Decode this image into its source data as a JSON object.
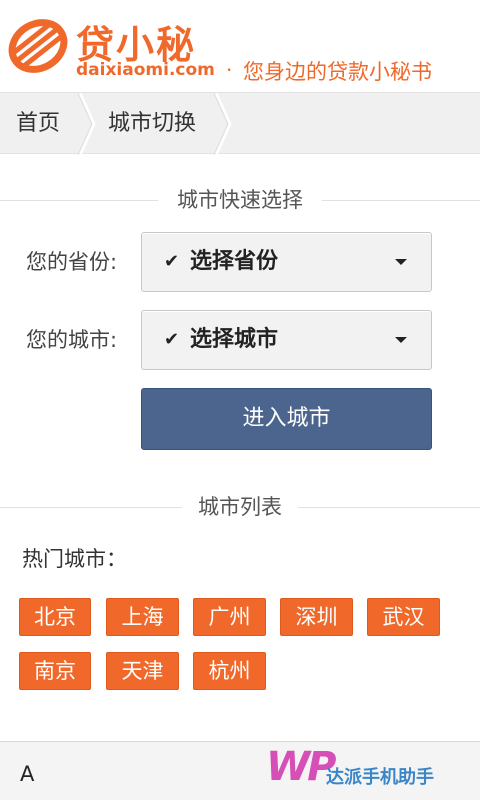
{
  "header": {
    "logo_title": "贷小秘",
    "logo_domain": "daixiaomi.com",
    "slogan_dot": "·",
    "slogan": "您身边的贷款小秘书",
    "brand_color": "#f0692a"
  },
  "breadcrumb": {
    "home": "首页",
    "current": "城市切换"
  },
  "quick_select": {
    "title": "城市快速选择",
    "province_label": "您的省份:",
    "province_value": "选择省份",
    "city_label": "您的城市:",
    "city_value": "选择城市",
    "check_mark": "✔",
    "enter_button": "进入城市",
    "button_color": "#4b658e"
  },
  "city_list": {
    "title": "城市列表",
    "hot_label": "热门城市：",
    "hot_cities": [
      "北京",
      "上海",
      "广州",
      "深圳",
      "武汉",
      "南京",
      "天津",
      "杭州"
    ]
  },
  "bottom_bar": {
    "letter": "A",
    "wp_logo": "WP",
    "wp_text": "达派手机助手"
  }
}
